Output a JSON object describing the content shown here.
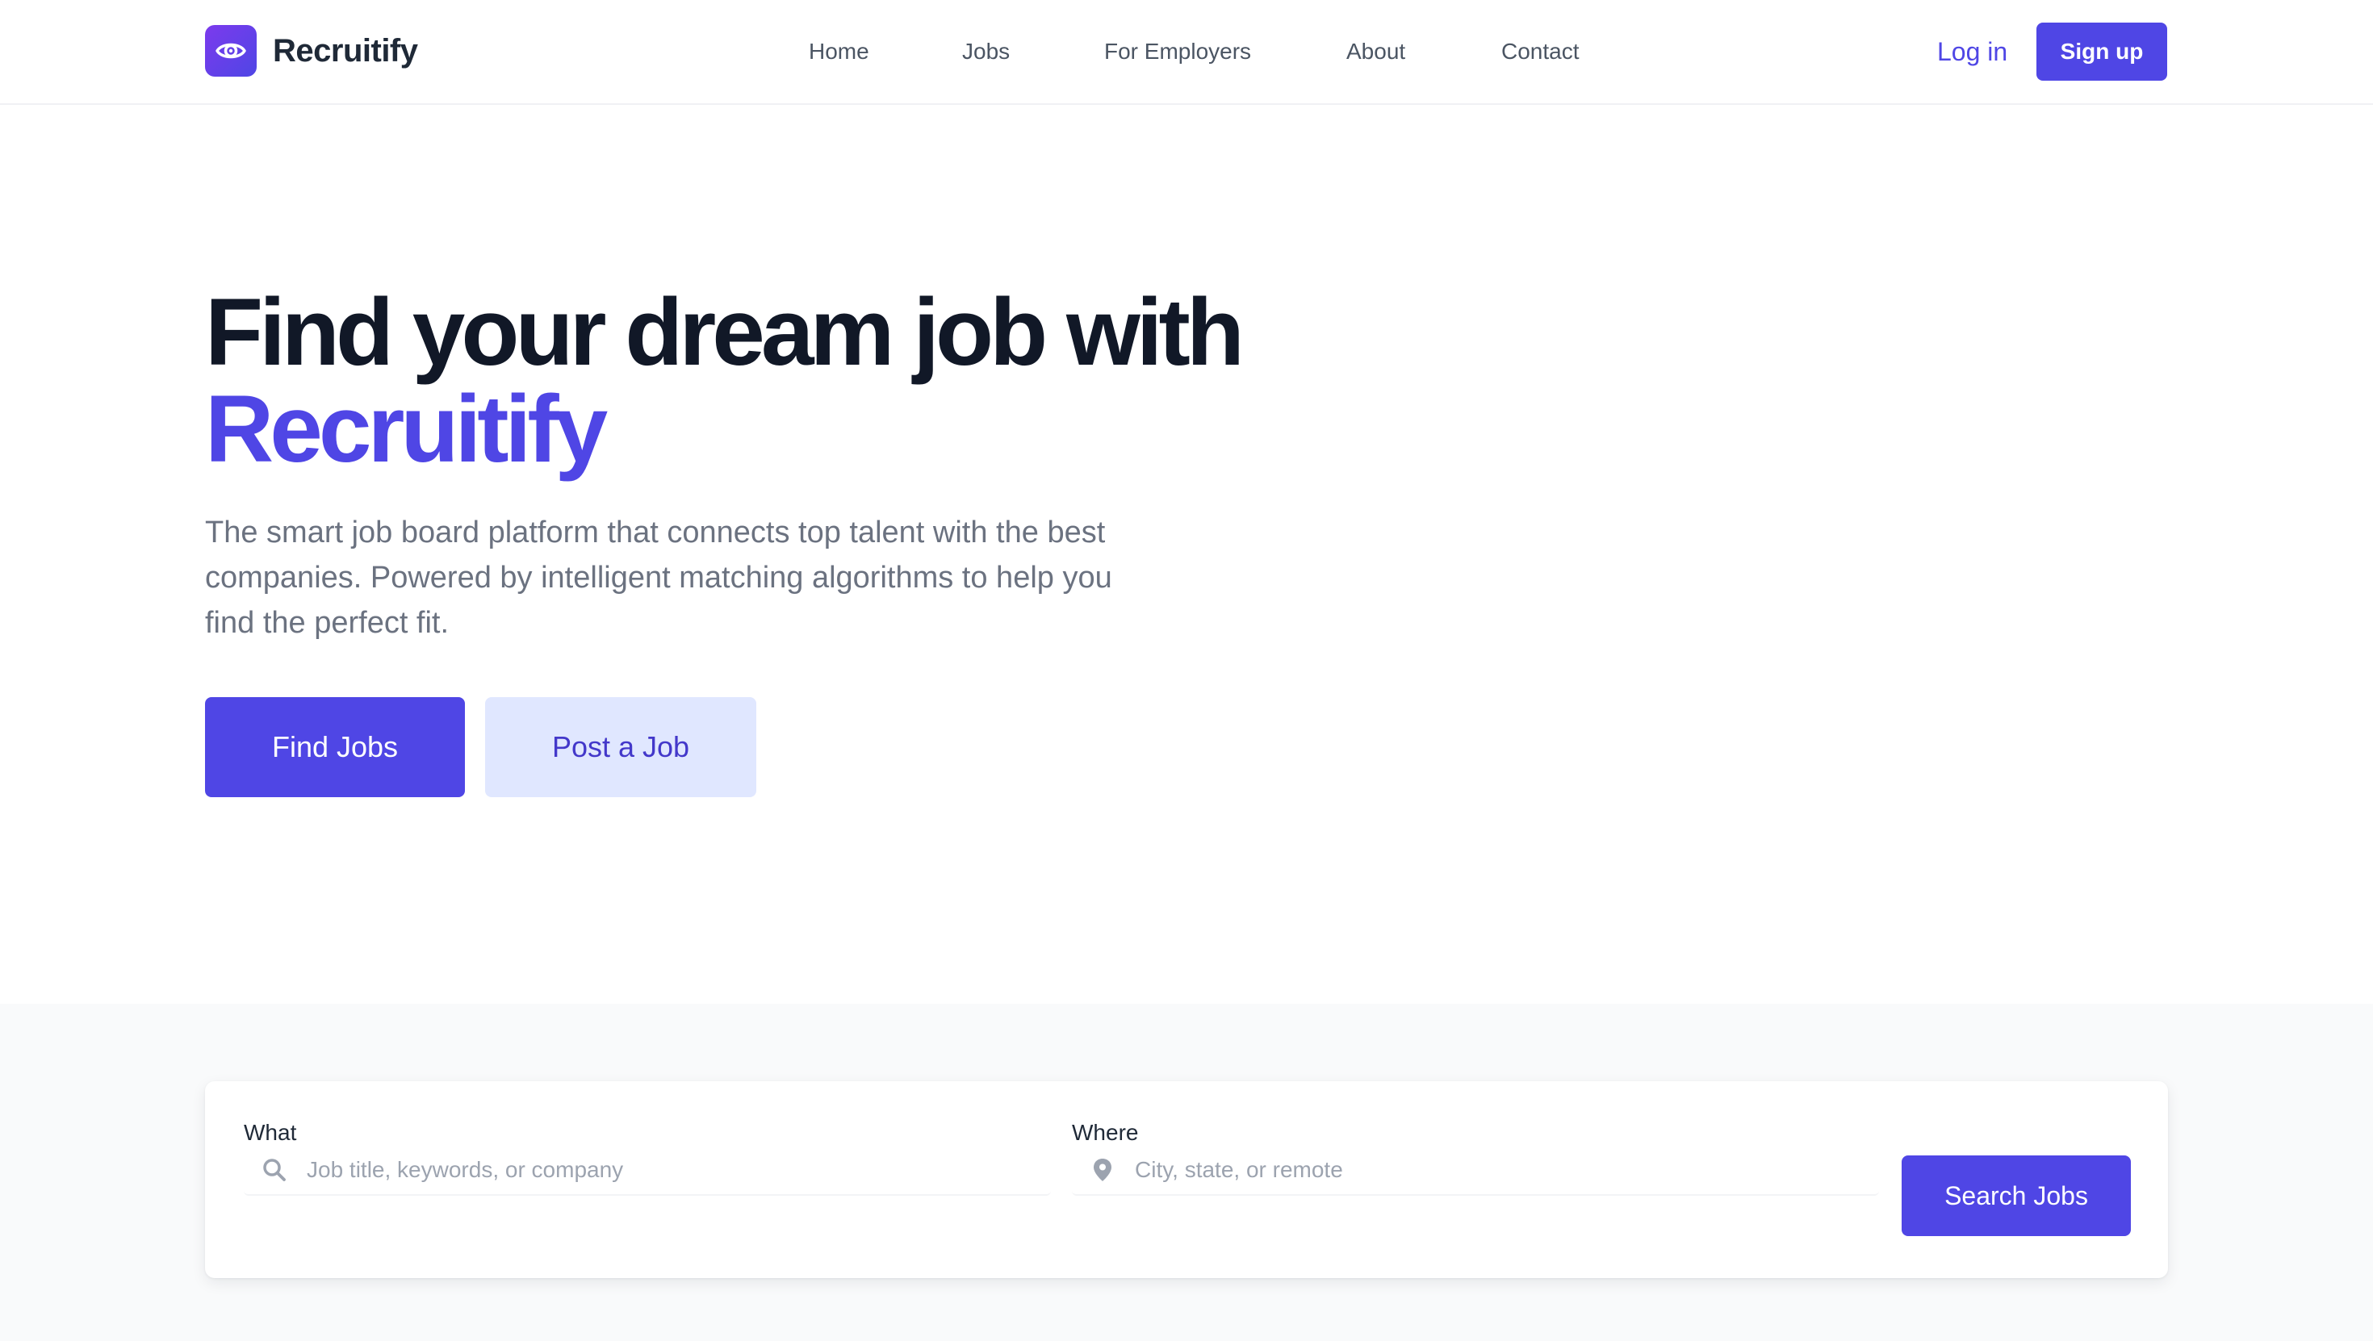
{
  "brand": {
    "name": "Recruitify",
    "logo_icon": "eye-icon",
    "logo_gradient": [
      "#7c3aed",
      "#4f46e5"
    ]
  },
  "nav": {
    "items": [
      {
        "label": "Home"
      },
      {
        "label": "Jobs"
      },
      {
        "label": "For Employers"
      },
      {
        "label": "About"
      },
      {
        "label": "Contact"
      }
    ],
    "login_label": "Log in",
    "signup_label": "Sign up"
  },
  "hero": {
    "title_line1": "Find your dream job with",
    "title_accent": "Recruitify",
    "subtitle": "The smart job board platform that connects top talent with the best companies. Powered by intelligent matching algorithms to help you find the perfect fit.",
    "primary_cta": "Find Jobs",
    "secondary_cta": "Post a Job"
  },
  "search": {
    "what_label": "What",
    "what_placeholder": "Job title, keywords, or company",
    "what_value": "",
    "what_icon": "search-icon",
    "where_label": "Where",
    "where_placeholder": "City, state, or remote",
    "where_value": "",
    "where_icon": "location-pin-icon",
    "submit_label": "Search Jobs"
  },
  "colors": {
    "primary": "#4f46e5",
    "primary_light": "#e0e7ff",
    "heading": "#111827",
    "body_text": "#6b7280",
    "band_bg": "#f9fafb"
  }
}
